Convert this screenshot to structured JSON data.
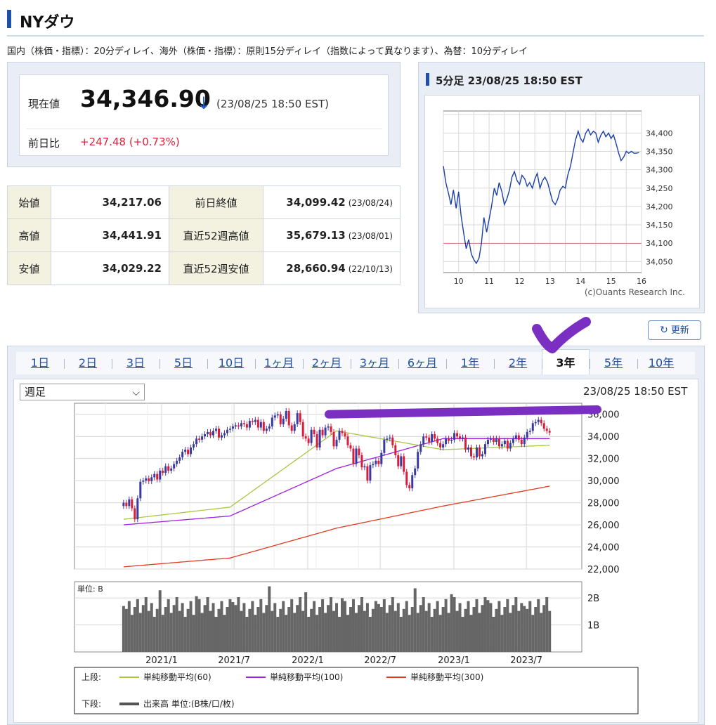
{
  "header": {
    "title": "NYダウ",
    "delay_note": "国内（株価・指標）：20分ディレイ、海外（株価・指標）：原則15分ディレイ（指数によって異なります）、為替：10分ディレイ"
  },
  "price": {
    "current_label": "現在値",
    "current_value": "34,346.90",
    "current_time": "(23/08/25 18:50 EST)",
    "change_label": "前日比",
    "change_value": "+247.48 (+0.73%)"
  },
  "stats": [
    {
      "label": "始値",
      "value": "34,217.06",
      "label2": "前日終値",
      "value2": "34,099.42",
      "date2": "(23/08/24)"
    },
    {
      "label": "高値",
      "value": "34,441.91",
      "label2": "直近52週高値",
      "value2": "35,679.13",
      "date2": "(23/08/01)"
    },
    {
      "label": "安値",
      "value": "34,029.22",
      "label2": "直近52週安値",
      "value2": "28,660.94",
      "date2": "(22/10/13)"
    }
  ],
  "intraday": {
    "title": "5分足 23/08/25 18:50 EST",
    "copyright": "(c)Ouants Research Inc."
  },
  "refresh_label": "更新",
  "tabs": [
    "1日",
    "2日",
    "3日",
    "5日",
    "10日",
    "1ヶ月",
    "2ヶ月",
    "3ヶ月",
    "6ヶ月",
    "1年",
    "2年",
    "3年",
    "5年",
    "10年"
  ],
  "active_tab": "3年",
  "chart": {
    "period_select": "週足",
    "timestamp": "23/08/25 18:50 EST",
    "volume_unit_label": "単位: B",
    "legend_upper_label": "上段:",
    "legend_lower_label": "下段:",
    "legend_ma60": "単純移動平均(60)",
    "legend_ma100": "単純移動平均(100)",
    "legend_ma300": "単純移動平均(300)",
    "legend_volume": "出来高 単位:(B株/口/枚)"
  },
  "colors": {
    "up": "#3a3aa0",
    "down": "#d81c3c",
    "ma60": "#a8c840",
    "ma100": "#a020e0",
    "ma300": "#e03a20",
    "intraday_line": "#1a40a8",
    "prev_close_line": "#e08080",
    "annotation": "#7a2fc2",
    "volume_bar": "#666666"
  },
  "chart_data": [
    {
      "type": "line",
      "title": "5分足 23/08/25 18:50 EST",
      "x_ticks": [
        "10",
        "11",
        "12",
        "13",
        "14",
        "15",
        "16"
      ],
      "y_ticks": [
        34050,
        34100,
        34150,
        34200,
        34250,
        34300,
        34350,
        34400
      ],
      "ylim": [
        34020,
        34460
      ],
      "xlim": [
        9.5,
        16
      ],
      "reference_line": 34099.42,
      "series": [
        {
          "x": [
            9.5,
            9.58,
            9.67,
            9.75,
            9.83,
            9.92,
            10.0,
            10.08,
            10.17,
            10.25,
            10.33,
            10.42,
            10.5,
            10.58,
            10.67,
            10.75,
            10.83,
            10.92,
            11.0,
            11.08,
            11.17,
            11.25,
            11.33,
            11.42,
            11.5,
            11.58,
            11.67,
            11.75,
            11.83,
            11.92,
            12.0,
            12.08,
            12.17,
            12.25,
            12.33,
            12.42,
            12.5,
            12.58,
            12.67,
            12.75,
            12.83,
            12.92,
            13.0,
            13.08,
            13.17,
            13.25,
            13.33,
            13.42,
            13.5,
            13.58,
            13.67,
            13.75,
            13.83,
            13.92,
            14.0,
            14.08,
            14.17,
            14.25,
            14.33,
            14.42,
            14.5,
            14.58,
            14.67,
            14.75,
            14.83,
            14.92,
            15.0,
            15.08,
            15.17,
            15.25,
            15.33,
            15.42,
            15.5,
            15.58,
            15.67,
            15.75,
            15.83,
            15.92
          ],
          "y": [
            34310,
            34265,
            34235,
            34205,
            34245,
            34195,
            34240,
            34175,
            34125,
            34085,
            34110,
            34070,
            34055,
            34045,
            34060,
            34100,
            34170,
            34130,
            34165,
            34200,
            34250,
            34230,
            34265,
            34240,
            34205,
            34220,
            34245,
            34280,
            34295,
            34270,
            34260,
            34285,
            34275,
            34255,
            34265,
            34250,
            34275,
            34290,
            34250,
            34270,
            34280,
            34265,
            34240,
            34215,
            34205,
            34220,
            34245,
            34255,
            34250,
            34285,
            34310,
            34345,
            34380,
            34405,
            34385,
            34375,
            34400,
            34410,
            34395,
            34405,
            34400,
            34375,
            34395,
            34405,
            34390,
            34400,
            34385,
            34395,
            34370,
            34345,
            34325,
            34335,
            34350,
            34345,
            34350,
            34345,
            34345,
            34347
          ]
        }
      ]
    },
    {
      "type": "candlestick",
      "title": "週足",
      "x_ticks": [
        "2021/1",
        "2021/7",
        "2022/1",
        "2022/7",
        "2023/1",
        "2023/7"
      ],
      "y_ticks": [
        22000,
        24000,
        26000,
        28000,
        30000,
        32000,
        34000,
        36000
      ],
      "ylim": [
        22000,
        37000
      ],
      "start": "2020-09-28",
      "close": [
        28000,
        27700,
        28300,
        27500,
        26500,
        28400,
        29900,
        30000,
        30200,
        29950,
        30300,
        30600,
        30100,
        30900,
        30700,
        31300,
        30900,
        31100,
        31500,
        31800,
        32100,
        32600,
        32800,
        32400,
        33000,
        33300,
        33800,
        33700,
        34000,
        34200,
        34400,
        34100,
        34500,
        34700,
        33900,
        34100,
        34300,
        34600,
        34700,
        34900,
        35000,
        34900,
        35200,
        35100,
        34800,
        35400,
        35300,
        35500,
        34800,
        35300,
        34500,
        34700,
        34900,
        35700,
        35900,
        36000,
        35100,
        35600,
        36300,
        35000,
        34500,
        35100,
        36100,
        35300,
        34000,
        33800,
        33400,
        34600,
        34200,
        33000,
        34600,
        34100,
        34800,
        34900,
        34400,
        33100,
        33700,
        34500,
        34300,
        34000,
        33200,
        32900,
        31500,
        32900,
        32300,
        31200,
        31300,
        30000,
        31400,
        31500,
        31800,
        31500,
        32500,
        33700,
        33800,
        33900,
        33200,
        32300,
        31300,
        32200,
        30800,
        29600,
        29300,
        30500,
        31100,
        32600,
        33300,
        34000,
        33900,
        33500,
        34200,
        33800,
        33400,
        33000,
        33300,
        33800,
        33600,
        33700,
        34300,
        34000,
        33800,
        33900,
        32800,
        33000,
        32200,
        32100,
        33000,
        32200,
        32400,
        33300,
        33700,
        33800,
        33500,
        33800,
        33100,
        33300,
        33600,
        32900,
        33400,
        33800,
        34100,
        33700,
        33300,
        33900,
        34400,
        34500,
        35200,
        35300,
        35500,
        35200,
        34700,
        34500,
        34346.9
      ],
      "ma60": [
        26500,
        27600,
        34500,
        32800,
        33200
      ],
      "ma100": [
        26000,
        26800,
        31100,
        33800,
        33800
      ],
      "ma300": [
        22200,
        23000,
        25700,
        27700,
        29500
      ],
      "volume_unit": "B",
      "volume_ticks": [
        "1B",
        "2B"
      ],
      "volume_range": [
        2.1,
        1.3
      ]
    }
  ]
}
